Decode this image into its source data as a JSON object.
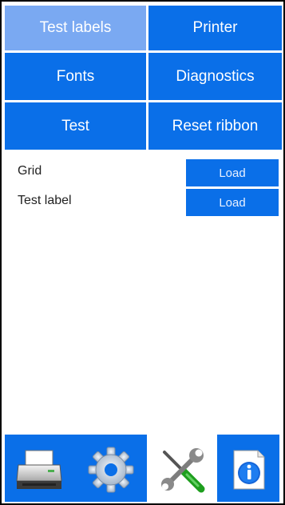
{
  "tabs": [
    {
      "label": "Test labels",
      "active": true
    },
    {
      "label": "Printer",
      "active": false
    },
    {
      "label": "Fonts",
      "active": false
    },
    {
      "label": "Diagnostics",
      "active": false
    },
    {
      "label": "Test",
      "active": false
    },
    {
      "label": "Reset ribbon",
      "active": false
    }
  ],
  "rows": [
    {
      "label": "Grid",
      "button": "Load"
    },
    {
      "label": "Test label",
      "button": "Load"
    }
  ],
  "bottom_nav": [
    {
      "icon": "printer-icon",
      "selected": false
    },
    {
      "icon": "gear-icon",
      "selected": false
    },
    {
      "icon": "tools-icon",
      "selected": true
    },
    {
      "icon": "info-icon",
      "selected": false
    }
  ],
  "colors": {
    "accent": "#0a6fe8",
    "active_tab": "#7aa9f2",
    "background": "#ffffff"
  }
}
